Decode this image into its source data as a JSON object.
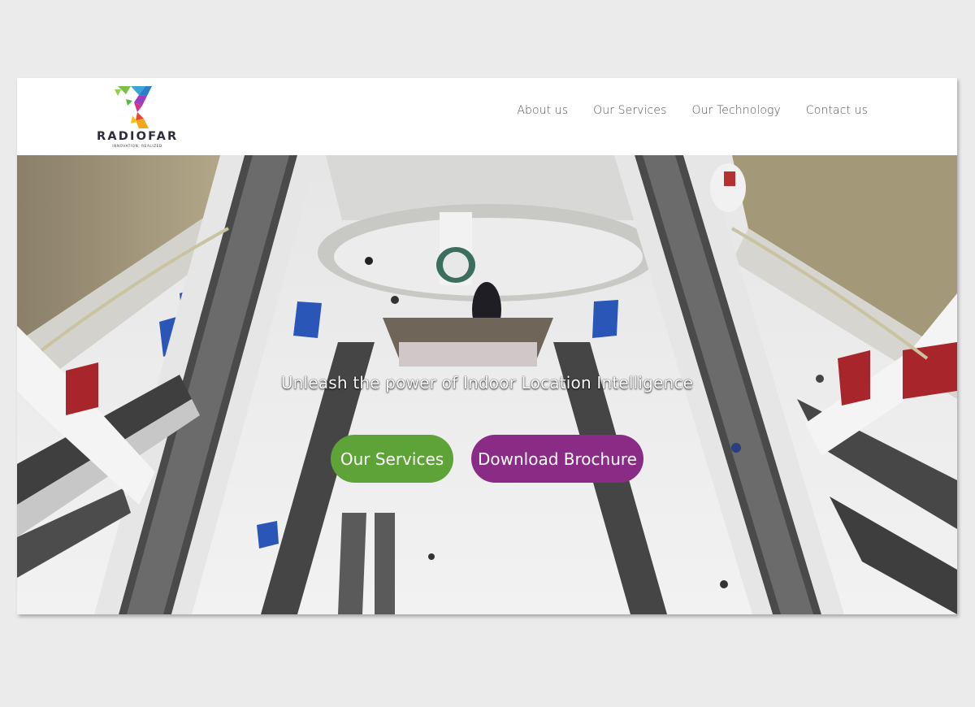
{
  "brand": {
    "name": "RADIOFAR",
    "tagline": "INNOVATION, REALIZED"
  },
  "nav": {
    "items": [
      {
        "label": "About us"
      },
      {
        "label": "Our Services"
      },
      {
        "label": "Our Technology"
      },
      {
        "label": "Contact us"
      }
    ]
  },
  "hero": {
    "headline": "Unleash the power of Indoor Location Intelligence",
    "primary_button": "Our Services",
    "secondary_button": "Download Brochure",
    "image_subject": "shopping-mall-atrium-escalators-photo"
  },
  "colors": {
    "primary_button": "#5ea338",
    "secondary_button": "#8a2b86",
    "nav_text": "#555555",
    "page_background": "#ebebeb"
  }
}
